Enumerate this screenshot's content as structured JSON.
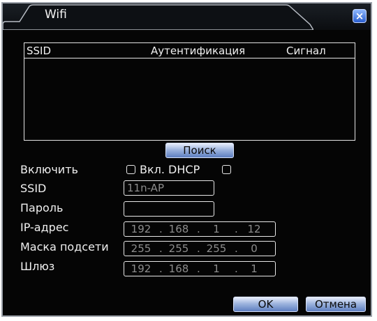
{
  "window": {
    "title": "Wifi",
    "close_glyph": "×"
  },
  "table": {
    "headers": {
      "ssid": "SSID",
      "auth": "Аутентификация",
      "signal": "Сигнал"
    },
    "rows": []
  },
  "buttons": {
    "search": "Поиск",
    "ok": "OK",
    "cancel": "Отмена"
  },
  "form": {
    "enable_label": "Включить",
    "enable_checked": false,
    "dhcp_label": "Вкл. DHCP",
    "dhcp_checked": false,
    "ssid_label": "SSID",
    "ssid_value": "11n-AP",
    "password_label": "Пароль",
    "password_value": "",
    "ip_label": "IP-адрес",
    "ip": [
      "192",
      "168",
      "1",
      "12"
    ],
    "mask_label": "Маска подсети",
    "mask": [
      "255",
      "255",
      "255",
      "0"
    ],
    "gateway_label": "Шлюз",
    "gateway": [
      "192",
      "168",
      "1",
      "1"
    ]
  },
  "icons": {
    "close": "close-icon",
    "checkbox": "checkbox-icon"
  },
  "colors": {
    "background": "#050505",
    "text": "#f0f0f0",
    "field_text": "#8c8c8c",
    "button_accent": "#5d7fc0",
    "close_button": "#2a5fcf"
  }
}
